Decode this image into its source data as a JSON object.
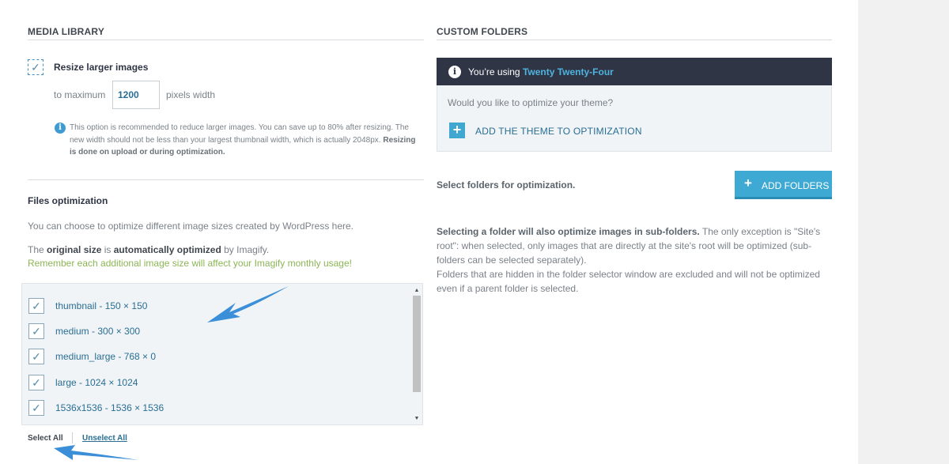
{
  "media_library": {
    "title": "MEDIA LIBRARY",
    "resize_label": "Resize larger images",
    "resize_checked_glyph": "✓",
    "to_max_label": "to maximum",
    "max_width_value": "1200",
    "pixels_label": "pixels width",
    "note_line1": "This option is recommended to reduce larger images. You can save up to 80% after resizing. The",
    "note_line2": "new width should not be less than your largest thumbnail width, which is actually 2048px.",
    "note_bold1": "Resizing",
    "note_bold2": "is done on upload or during optimization."
  },
  "files_optimization": {
    "title": "Files optimization",
    "intro": "You can choose to optimize different image sizes created by WordPress here.",
    "original_pre": "The",
    "original_b1": "original size",
    "original_mid": "is",
    "original_b2": "automatically optimized",
    "original_post": "by Imagify.",
    "warning": "Remember each additional image size will affect your Imagify monthly usage!",
    "warning_color": "#8cb555",
    "sizes": [
      {
        "label": "thumbnail - 150 × 150",
        "checked": true
      },
      {
        "label": "medium - 300 × 300",
        "checked": true
      },
      {
        "label": "medium_large - 768 × 0",
        "checked": true
      },
      {
        "label": "large - 1024 × 1024",
        "checked": true
      },
      {
        "label": "1536x1536 - 1536 × 1536",
        "checked": true
      }
    ],
    "check_glyph": "✓",
    "select_all": "Select All",
    "unselect_all": "Unselect All"
  },
  "custom_folders": {
    "title": "CUSTOM FOLDERS",
    "using_prefix": "You’re using",
    "theme_name": "Twenty Twenty-Four",
    "question": "Would you like to optimize your theme?",
    "add_theme": "ADD THE THEME TO OPTIMIZATION",
    "select_label": "Select folders for optimization.",
    "add_folders": "ADD FOLDERS",
    "para_bold": "Selecting a folder will also optimize images in sub-folders.",
    "para_rest": "The only exception is \"Site's root\": when selected, only images that are directly at the site's root will be optimized (sub-folders can be selected separately).",
    "para_second": "Folders that are hidden in the folder selector window are excluded and will not be optimized even if a parent folder is selected.",
    "accent": "#3eaad4",
    "header_bg": "#2f3544"
  },
  "icons": {
    "info": "i",
    "plus": "+"
  }
}
